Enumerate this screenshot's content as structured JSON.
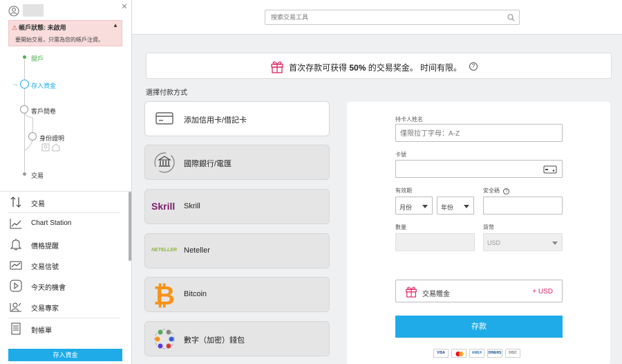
{
  "sidebar": {
    "close_glyph": "×",
    "account_status": "帳戶狀態: 未啟用",
    "account_notice": "要開始交易，只需為您的帳戶注資。",
    "steps": [
      {
        "label": "開戶",
        "state": "done"
      },
      {
        "label": "存入資金",
        "state": "current"
      },
      {
        "label": "客戶問卷",
        "state": "pending"
      },
      {
        "label": "身份證明",
        "state": "pending"
      },
      {
        "label": "交易",
        "state": "pending"
      }
    ],
    "menu": [
      {
        "label": "交易",
        "icon": "arrows-updown-icon"
      },
      {
        "label": "Chart Station",
        "icon": "chart-line-icon"
      },
      {
        "label": "價格提醒",
        "icon": "bell-icon"
      },
      {
        "label": "交易信號",
        "icon": "signal-chart-icon"
      },
      {
        "label": "今天的機會",
        "icon": "play-icon"
      },
      {
        "label": "交易專家",
        "icon": "expert-icon"
      },
      {
        "label": "對帳單",
        "icon": "statement-icon"
      }
    ],
    "deposit_button": "存入資金"
  },
  "search": {
    "placeholder": "搜索交易工具"
  },
  "promo": {
    "text_before": "首次存款可获得 ",
    "text_bold": "50%",
    "text_after": " 的交易奖金。 时间有限。",
    "info_glyph": "?"
  },
  "payment": {
    "title": "選擇付款方式",
    "methods": [
      {
        "label": "添加信用卡/借記卡",
        "icon": "credit-card-icon",
        "active": true
      },
      {
        "label": "國際銀行/電匯",
        "icon": "bank-transfer-icon",
        "active": false
      },
      {
        "label": "Skrill",
        "icon": "skrill-logo",
        "logo_text": "Skrill",
        "active": false
      },
      {
        "label": "Neteller",
        "icon": "neteller-logo",
        "logo_text": "NETELLER",
        "active": false
      },
      {
        "label": "Bitcoin",
        "icon": "bitcoin-icon",
        "active": false
      },
      {
        "label": "數字（加密）錢包",
        "icon": "crypto-wallet-icon",
        "active": false
      }
    ]
  },
  "form": {
    "cardholder_label": "持卡人姓名",
    "cardholder_placeholder": "僅限拉丁字母：A-Z",
    "card_number_label": "卡號",
    "expiry_label": "有效期",
    "month_value": "月份",
    "year_value": "年份",
    "cvv_label": "安全碼",
    "cvv_info_glyph": "?",
    "amount_label": "數量",
    "currency_label": "貨幣",
    "currency_value": "USD",
    "bonus_label": "交易贈金",
    "bonus_add": "+ USD",
    "deposit_button": "存款",
    "card_brands": [
      "VISA",
      "MC",
      "AMEX",
      "DINERS",
      "DISC"
    ]
  },
  "colors": {
    "accent": "#1eabe8",
    "success": "#4caf50",
    "bonus_pink": "#e0245e",
    "warning_bg": "#f9dcdc"
  }
}
